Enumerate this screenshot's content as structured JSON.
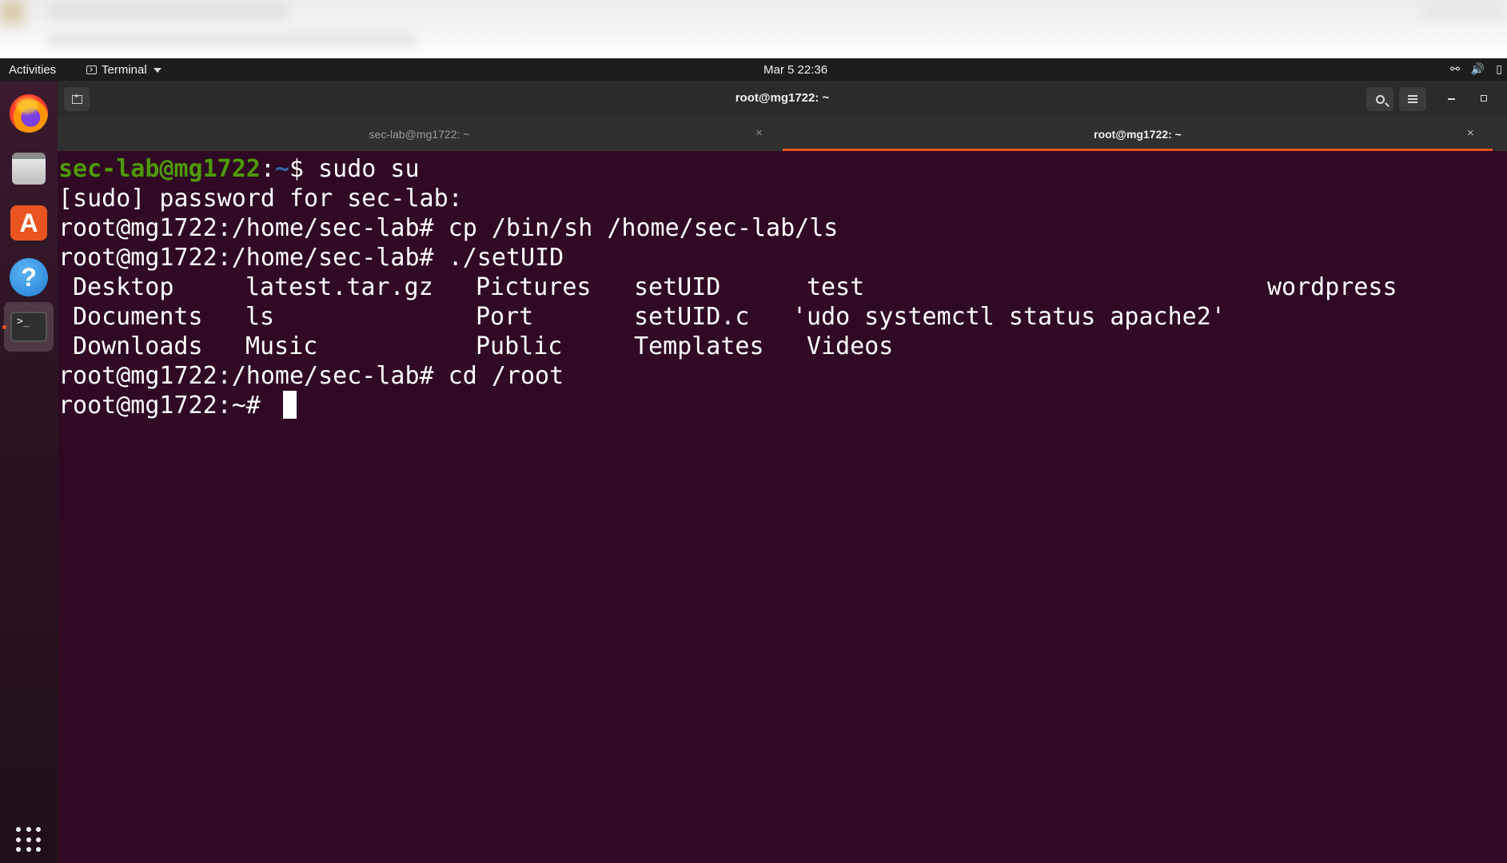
{
  "topbar": {
    "activities": "Activities",
    "app_name": "Terminal",
    "clock": "Mar 5  22:36"
  },
  "dock": {
    "apps": [
      "firefox-icon",
      "files-icon",
      "software-store-icon",
      "help-icon",
      "terminal-icon"
    ],
    "show_apps": "show-apps-grid-icon"
  },
  "window": {
    "title": "root@mg1722: ~"
  },
  "tabs": [
    {
      "label": "sec-lab@mg1722: ~",
      "active": false
    },
    {
      "label": "root@mg1722: ~",
      "active": true
    }
  ],
  "colors": {
    "background": "#300a24",
    "accent": "#e95420",
    "prompt_user": "#4e9a06",
    "prompt_path": "#3465a4"
  },
  "terminal": {
    "line1": {
      "user": "sec-lab@mg1722",
      "sep": ":",
      "path": "~",
      "rest": "$ sudo su"
    },
    "line2": "[sudo] password for sec-lab:",
    "line3": "root@mg1722:/home/sec-lab# cp /bin/sh /home/sec-lab/ls",
    "line4": "root@mg1722:/home/sec-lab# ./setUID",
    "ls_output": [
      [
        "Desktop",
        "latest.tar.gz",
        "Pictures",
        "setUID",
        "test",
        "wordpress"
      ],
      [
        "Documents",
        "ls",
        "Port",
        "setUID.c",
        "'udo systemctl status apache2'"
      ],
      [
        "Downloads",
        "Music",
        "Public",
        "Templates",
        "Videos"
      ]
    ],
    "line8": "root@mg1722:/home/sec-lab# cd /root",
    "line9": "root@mg1722:~# "
  }
}
